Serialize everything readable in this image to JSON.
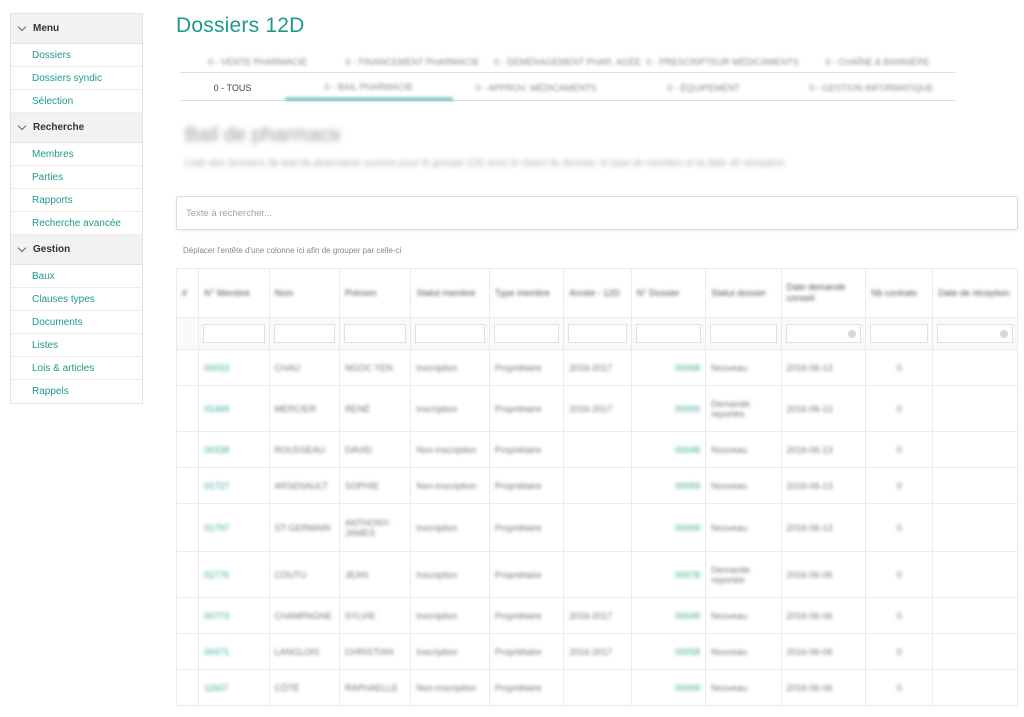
{
  "page": {
    "title": "Dossiers 12D"
  },
  "sidebar": {
    "sections": [
      {
        "label": "Menu",
        "items": [
          "Dossiers",
          "Dossiers syndic",
          "Sélection"
        ]
      },
      {
        "label": "Recherche",
        "items": [
          "Membres",
          "Parties",
          "Rapports",
          "Recherche avancée"
        ]
      },
      {
        "label": "Gestion",
        "items": [
          "Baux",
          "Clauses types",
          "Documents",
          "Listes",
          "Lois & articles",
          "Rappels"
        ]
      }
    ]
  },
  "tabs": {
    "row1": [
      "0 - VENTE PHARMACIE",
      "0 - FINANCEMENT PHARMACIE",
      "0 - DÉMÉNAGEMENT PHAR. AGÉE",
      "0 - PRESCRIPTEUR MÉDICAMENTS",
      "0 - CHAÎNE & BANNIÈRE"
    ],
    "row2": [
      "0 - TOUS",
      "0 - BAIL PHARMACIE",
      "0 - APPROV. MÉDICAMENTS",
      "0 - ÉQUIPEMENT",
      "0 - GESTION INFORMATIQUE"
    ],
    "active_row2_index": 1
  },
  "hero": {
    "title": "Bail de pharmacie",
    "subtitle": "Liste des dossiers de bail de pharmacie ouverts pour le groupe 12D avec le statut du dossier, le type de membre et la date de réception"
  },
  "search": {
    "placeholder": "Texte à rechercher..."
  },
  "group_hint": "Déplacer l'entête d'une colonne ici afin de grouper par celle-ci",
  "grid": {
    "columns": [
      "#",
      "N° Membre",
      "Nom",
      "Prénom",
      "Statut membre",
      "Type membre",
      "Année - 12D",
      "N° Dossier",
      "Statut dossier",
      "Date demande conseil",
      "Nb contrats",
      "Date de réception"
    ],
    "rows": [
      [
        "",
        "00033",
        "CHAU",
        "NGOC YEN",
        "Inscription",
        "Propriétaire",
        "2016-2017",
        "00068",
        "Nouveau",
        "2016-06-13",
        "0",
        ""
      ],
      [
        "",
        "01469",
        "MERCIER",
        "RENÉ",
        "Inscription",
        "Propriétaire",
        "2016-2017",
        "00055",
        "Demande reportée",
        "2016-06-13",
        "0",
        ""
      ],
      [
        "",
        "00338",
        "ROUSSEAU",
        "DAVID",
        "Non-inscription",
        "Propriétaire",
        "",
        "00048",
        "Nouveau",
        "2016-06-13",
        "0",
        ""
      ],
      [
        "",
        "01727",
        "ARSENAULT",
        "SOPHIE",
        "Non-inscription",
        "Propriétaire",
        "",
        "00059",
        "Nouveau",
        "2016-06-13",
        "0",
        ""
      ],
      [
        "",
        "01797",
        "ST-GERMAIN",
        "ANTHONY-JAMES",
        "Inscription",
        "Propriétaire",
        "",
        "00069",
        "Nouveau",
        "2016-06-13",
        "0",
        ""
      ],
      [
        "",
        "01776",
        "COUTU",
        "JEAN",
        "Inscription",
        "Propriétaire",
        "",
        "00078",
        "Demande reportée",
        "2016-06-06",
        "0",
        ""
      ],
      [
        "",
        "00773",
        "CHAMPAGNE",
        "SYLVIE",
        "Inscription",
        "Propriétaire",
        "2016-2017",
        "00049",
        "Nouveau",
        "2016-06-06",
        "0",
        ""
      ],
      [
        "",
        "00471",
        "LANGLOIS",
        "CHRISTIAN",
        "Inscription",
        "Propriétaire",
        "2016-2017",
        "00058",
        "Nouveau",
        "2016-06-06",
        "0",
        ""
      ],
      [
        "",
        "11607",
        "CÔTÉ",
        "RAPHAELLE",
        "Non-inscription",
        "Propriétaire",
        "",
        "00069",
        "Nouveau",
        "2016-06-06",
        "0",
        ""
      ]
    ],
    "row_heights": [
      36,
      46,
      36,
      36,
      48,
      46,
      36,
      36,
      36
    ]
  }
}
